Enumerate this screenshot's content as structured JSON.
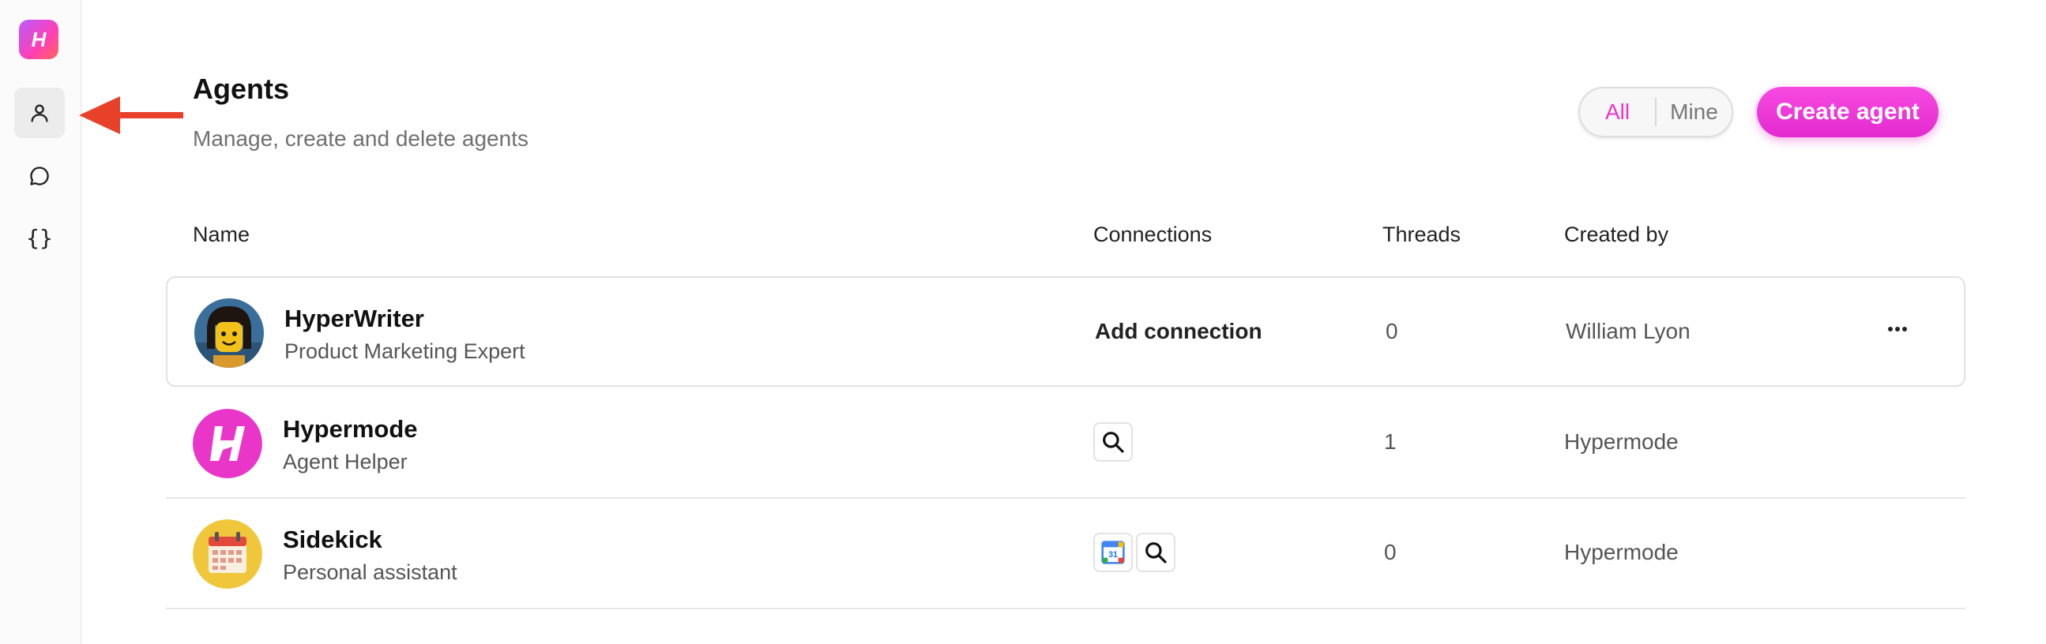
{
  "sidebar": {
    "logo_letter": "H",
    "nav": [
      {
        "name": "agents",
        "icon": "person-icon",
        "active": true
      },
      {
        "name": "chat",
        "icon": "chat-bubble-icon",
        "active": false
      },
      {
        "name": "code",
        "icon": "braces-icon",
        "glyph": "{}",
        "active": false
      }
    ]
  },
  "header": {
    "title": "Agents",
    "subtitle": "Manage, create and delete agents",
    "filter": {
      "options": [
        "All",
        "Mine"
      ],
      "selected": "All"
    },
    "create_label": "Create agent"
  },
  "table": {
    "columns": [
      "Name",
      "Connections",
      "Threads",
      "Created by"
    ],
    "rows": [
      {
        "name": "HyperWriter",
        "description": "Product Marketing Expert",
        "avatar": "lego-figure-avatar",
        "connections_label": "Add connection",
        "connections": [],
        "threads": "0",
        "created_by": "William Lyon",
        "highlighted": true
      },
      {
        "name": "Hypermode",
        "description": "Agent Helper",
        "avatar": "hypermode-logo-avatar",
        "connections": [
          "search-icon"
        ],
        "threads": "1",
        "created_by": "Hypermode"
      },
      {
        "name": "Sidekick",
        "description": "Personal assistant",
        "avatar": "calendar-avatar",
        "connections": [
          "google-calendar-icon",
          "search-icon"
        ],
        "calendar_day": "31",
        "threads": "0",
        "created_by": "Hypermode"
      }
    ]
  },
  "annotations": {
    "arrow_color": "#e8412a"
  },
  "colors": {
    "accent": "#ea35c9",
    "border": "#e3e3e3"
  }
}
